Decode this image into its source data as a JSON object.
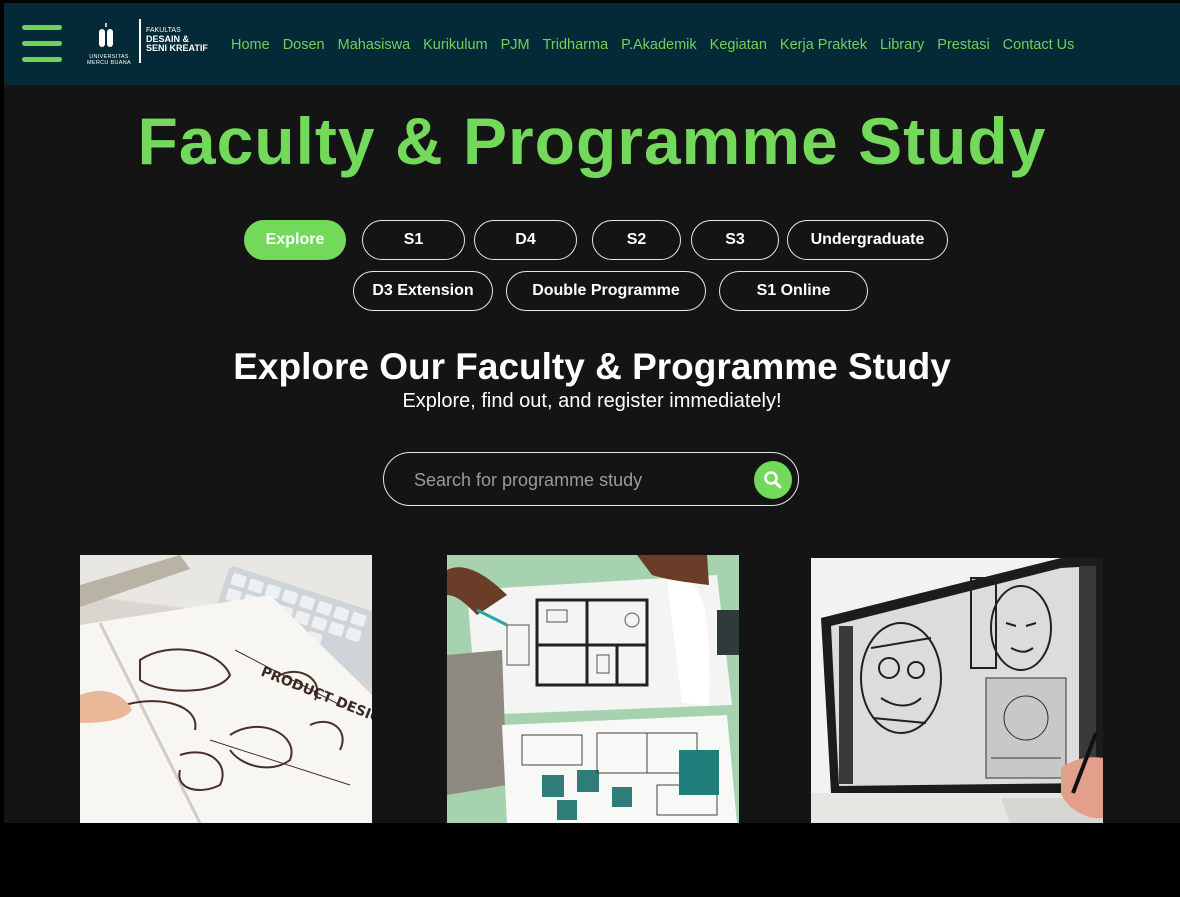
{
  "header": {
    "logo": {
      "university": "UNIVERSITAS MERCU BUANA",
      "line1": "FAKULTAS",
      "line2": "DESAIN &",
      "line3": "SENI KREATIF"
    },
    "nav": [
      "Home",
      "Dosen",
      "Mahasiswa",
      "Kurikulum",
      "PJM",
      "Tridharma",
      "P.Akademik",
      "Kegiatan",
      "Kerja Praktek",
      "Library",
      "Prestasi",
      "Contact Us"
    ]
  },
  "hero": {
    "title": "Faculty & Programme Study"
  },
  "filters": {
    "active": "Explore",
    "items": [
      "Explore",
      "S1",
      "D4",
      "S2",
      "S3",
      "Undergraduate",
      "D3 Extension",
      "Double Programme",
      "S1 Online"
    ]
  },
  "explore": {
    "title": "Explore Our Faculty & Programme Study",
    "tagline": "Explore, find out, and register immediately!"
  },
  "search": {
    "placeholder": "Search for programme study",
    "icon": "search-icon"
  },
  "colors": {
    "accent": "#72d95a",
    "header_bg": "#032a36",
    "page_bg": "#141414"
  },
  "cards": [
    {
      "image": "product-design-sketch-image"
    },
    {
      "image": "interior-floor-plan-image"
    },
    {
      "image": "digital-illustration-monitor-image"
    }
  ]
}
